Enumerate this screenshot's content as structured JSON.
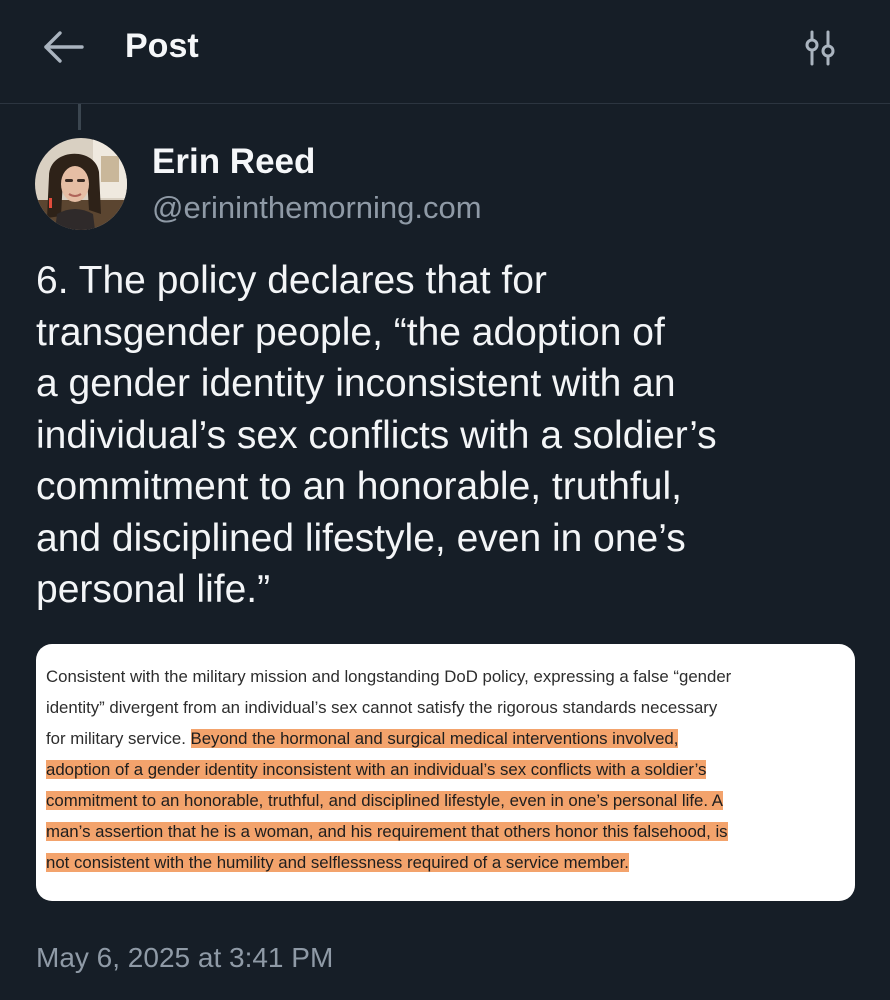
{
  "header": {
    "title": "Post",
    "back_icon": "arrow-left-icon",
    "filter_icon": "sliders-icon"
  },
  "author": {
    "name": "Erin Reed",
    "handle": "@erininthemorning.com",
    "avatar_icon": "user-avatar"
  },
  "post": {
    "text": "6. The policy declares that for\ntransgender people, “the adoption of\na gender identity inconsistent with an\nindividual’s sex conflicts with a soldier’s\ncommitment to an honorable, truthful,\nand disciplined lifestyle, even in one’s\npersonal life.”",
    "timestamp": "May 6, 2025 at 3:41 PM"
  },
  "embed": {
    "highlight_color": "#f3a36c",
    "lines": [
      {
        "plain": "Consistent with the military mission and longstanding DoD policy, expressing a false “gender",
        "highlighted": ""
      },
      {
        "plain": "identity” divergent from an individual’s sex cannot satisfy the rigorous standards necessary",
        "highlighted": ""
      },
      {
        "plain": "for military service. ",
        "highlighted": "Beyond the hormonal and surgical medical interventions involved,"
      },
      {
        "plain": "",
        "highlighted": "adoption of a gender identity inconsistent with an individual’s sex conflicts with a soldier’s"
      },
      {
        "plain": "",
        "highlighted": "commitment to an honorable, truthful, and disciplined lifestyle, even in one’s personal life.  A"
      },
      {
        "plain": "",
        "highlighted": "man’s assertion that he is a woman, and his requirement that others honor this falsehood, is"
      },
      {
        "plain": "",
        "highlighted": "not consistent with the humility and selflessness required of a service member."
      }
    ]
  },
  "colors": {
    "background": "#161e27",
    "text_primary": "#f3f5f7",
    "text_secondary": "#8f9aa6",
    "divider": "#2c3540"
  }
}
